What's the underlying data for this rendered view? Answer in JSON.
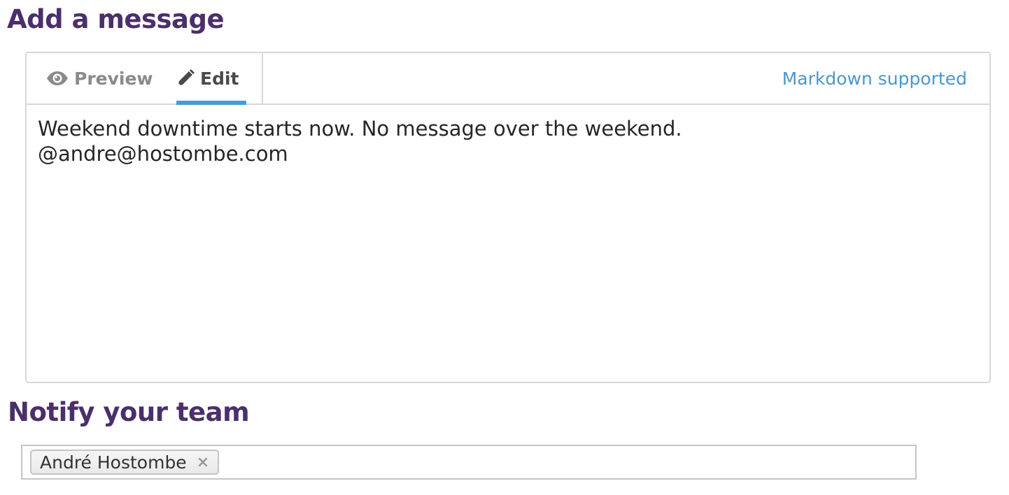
{
  "headings": {
    "add_message": "Add a message",
    "notify_team": "Notify your team"
  },
  "editor": {
    "tabs": [
      {
        "label": "Preview",
        "icon": "eye-icon",
        "active": false
      },
      {
        "label": "Edit",
        "icon": "pencil-icon",
        "active": true
      }
    ],
    "markdown_link": "Markdown supported",
    "message_text": "Weekend downtime starts now. No message over the weekend.\n@andre@hostombe.com"
  },
  "notify": {
    "recipients": [
      {
        "name": "André Hostombe",
        "remove_symbol": "×"
      }
    ]
  },
  "colors": {
    "heading": "#4b2f6b",
    "accent": "#4a9ad4",
    "link": "#4a98c9",
    "border": "#d8d8d8"
  }
}
